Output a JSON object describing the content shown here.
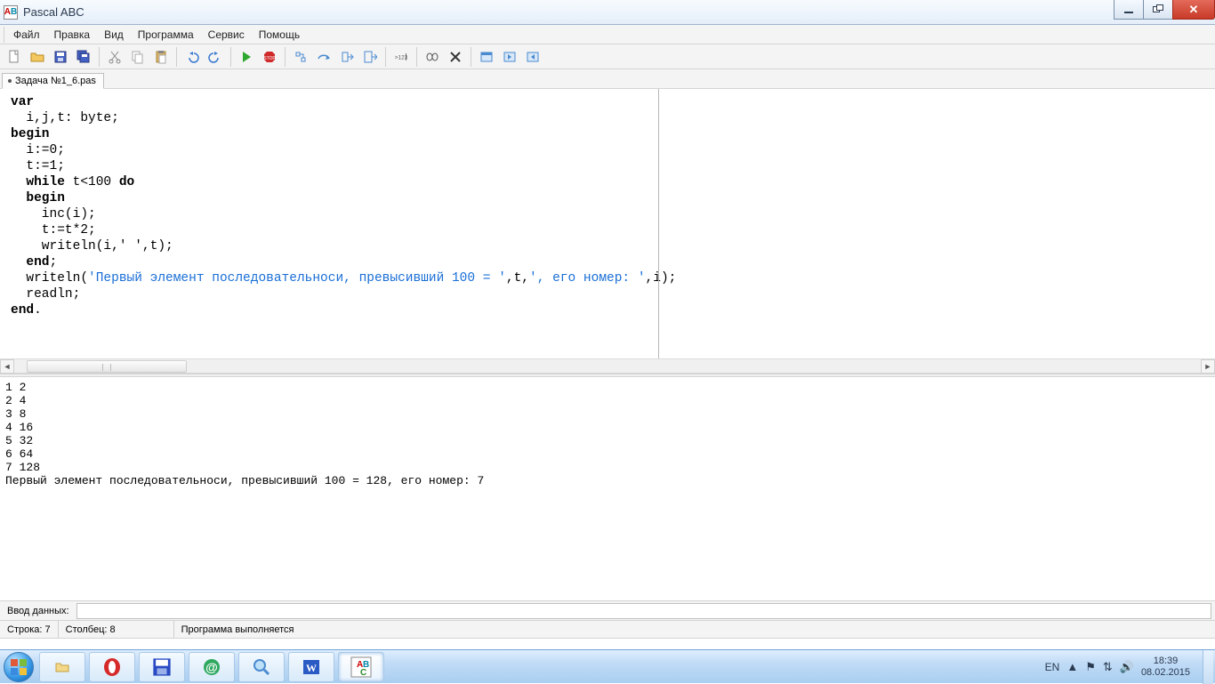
{
  "window": {
    "title": "Pascal ABC"
  },
  "menu": {
    "file": "Файл",
    "edit": "Правка",
    "view": "Вид",
    "program": "Программа",
    "service": "Сервис",
    "help": "Помощь"
  },
  "tab": {
    "filename": "Задача №1_6.pas"
  },
  "code": {
    "l1_kw": "var",
    "l2": "  i,j,t: byte;",
    "l3_kw": "begin",
    "l4": "  i:=0;",
    "l5": "  t:=1;",
    "l6a": "  ",
    "l6_kw1": "while",
    "l6b": " t<100 ",
    "l6_kw2": "do",
    "l7a": "  ",
    "l7_kw": "begin",
    "l8": "    inc(i);",
    "l9": "    t:=t*2;",
    "l10": "    writeln(i,' ',t);",
    "l11a": "  ",
    "l11_kw": "end",
    "l11b": ";",
    "l12a": "  writeln(",
    "l12_str1": "'Первый элемент последовательноси, превысивший 100 = '",
    "l12b": ",t,",
    "l12_str2": "', его номер: '",
    "l12c": ",i);",
    "l13": "  readln;",
    "l14_kw": "end",
    "l14b": "."
  },
  "output_lines": [
    "1 2",
    "2 4",
    "3 8",
    "4 16",
    "5 32",
    "6 64",
    "7 128",
    "Первый элемент последовательноси, превысивший 100 = 128, его номер: 7"
  ],
  "input_row": {
    "label": "Ввод данных:",
    "value": ""
  },
  "status": {
    "line_label": "Строка: 7",
    "col_label": "Столбец: 8",
    "msg": "Программа выполняется"
  },
  "tray": {
    "lang": "EN",
    "time": "18:39",
    "date": "08.02.2015"
  }
}
